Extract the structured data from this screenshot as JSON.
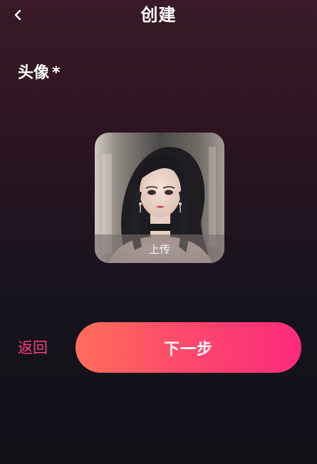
{
  "header": {
    "title": "创建",
    "back_icon": "chevron-left-icon"
  },
  "form": {
    "avatar_label": "头像",
    "required_mark": "*"
  },
  "avatar": {
    "upload_label": "上传"
  },
  "actions": {
    "return_label": "返回",
    "next_label": "下一步"
  },
  "colors": {
    "accent_pink": "#ff3d7f",
    "button_gradient_start": "#ff6e5a",
    "button_gradient_end": "#fb2a7b",
    "background_top": "#3a1a28",
    "background_bottom": "#121219"
  }
}
